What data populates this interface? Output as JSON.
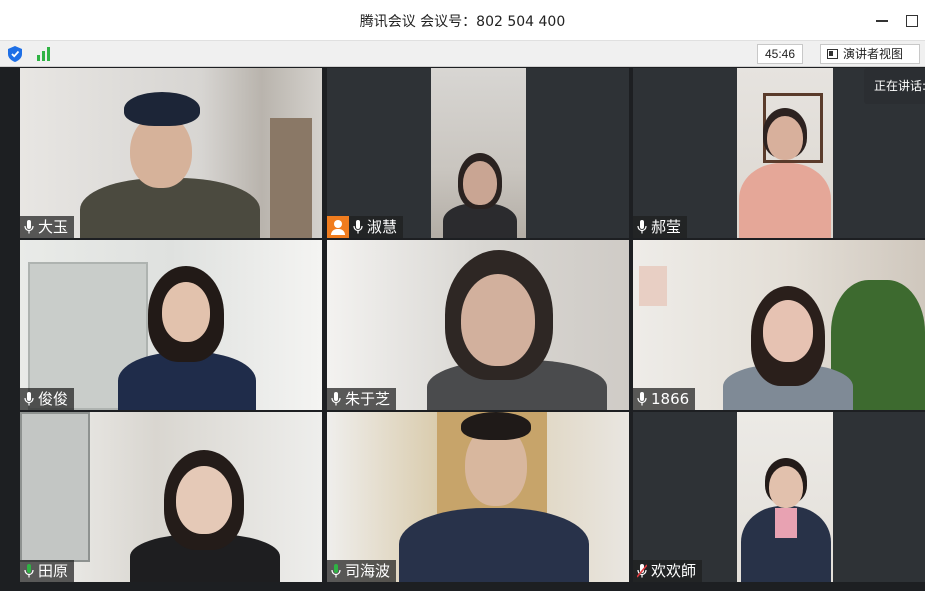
{
  "window": {
    "title": "腾讯会议 会议号：802 504 400"
  },
  "toolbar": {
    "timer": "45:46",
    "presenter_view_label": "演讲者视图",
    "speaking_tip": "正在讲话:"
  },
  "participants": [
    {
      "name": "大玉",
      "mic": "on"
    },
    {
      "name": "淑慧",
      "mic": "on",
      "avatar_badge": true
    },
    {
      "name": "郝莹",
      "mic": "on"
    },
    {
      "name": "俊俊",
      "mic": "on",
      "active_speaker": true
    },
    {
      "name": "朱于芝",
      "mic": "on"
    },
    {
      "name": "1866",
      "mic": "on"
    },
    {
      "name": "田原",
      "mic": "on-green"
    },
    {
      "name": "司海波",
      "mic": "on-green"
    },
    {
      "name": "欢欢師",
      "mic": "muted"
    }
  ],
  "colors": {
    "active_border": "#2fb344",
    "mic_green": "#2fb344",
    "mic_muted": "#e0393e",
    "avatar_orange": "#f07c1e"
  }
}
